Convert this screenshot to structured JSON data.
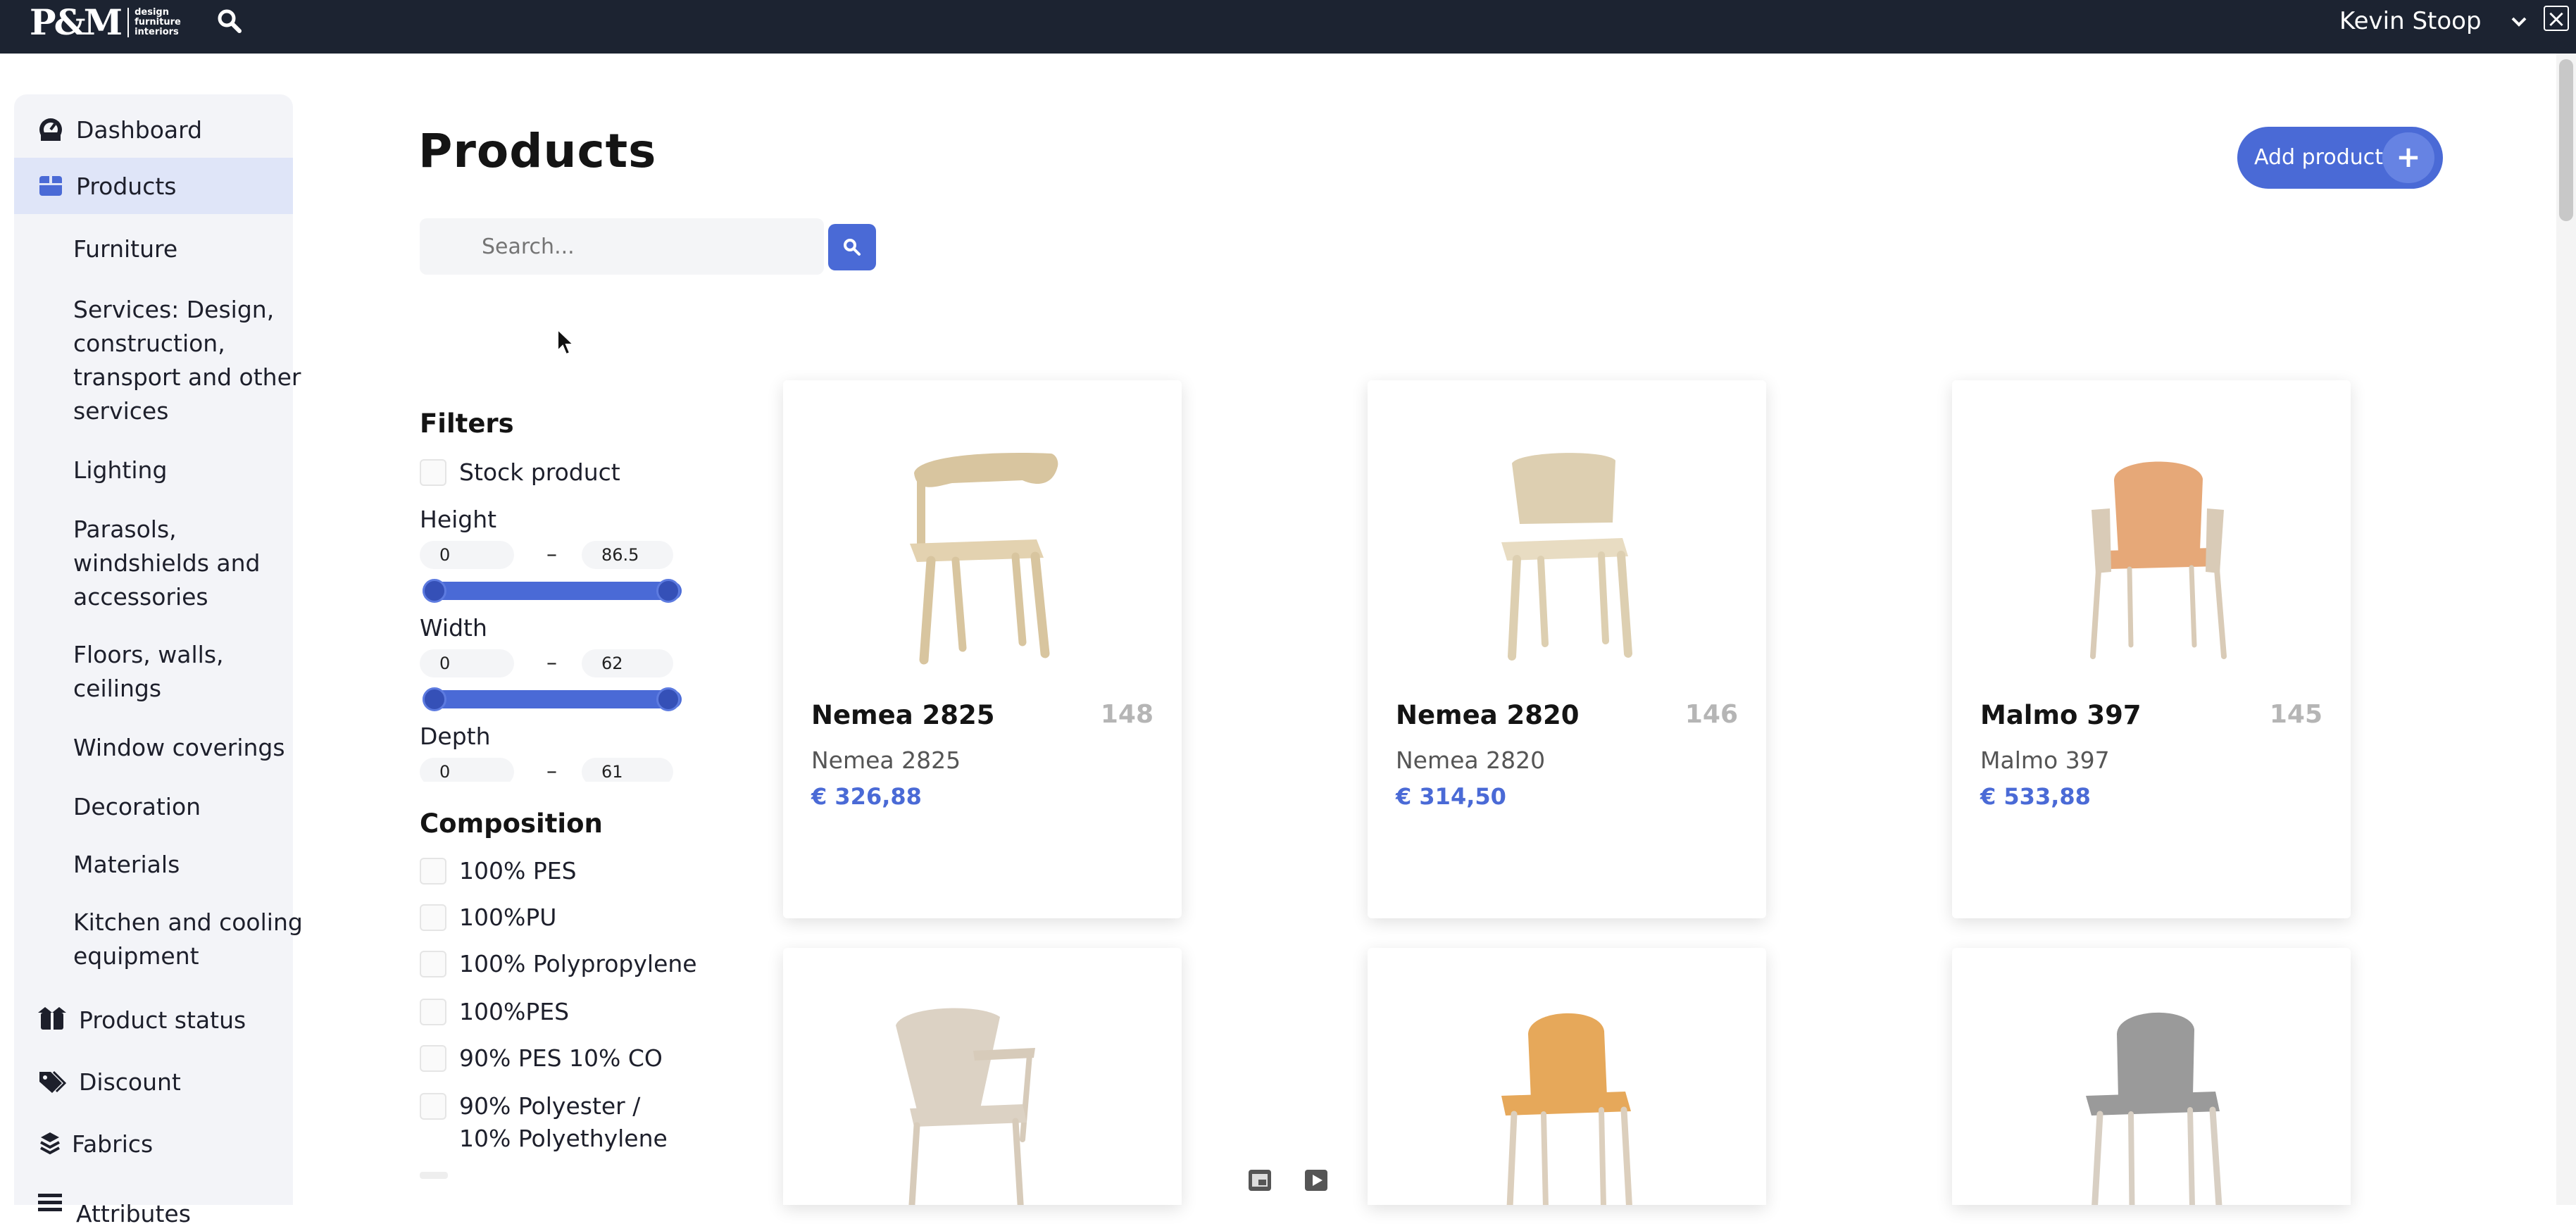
{
  "header": {
    "logo_mark": "P&M",
    "logo_sub": [
      "design",
      "furniture",
      "interiors"
    ],
    "user_name": "Kevin Stoop"
  },
  "sidebar": {
    "items": [
      {
        "label": "Dashboard",
        "icon": "dashboard-icon"
      },
      {
        "label": "Products",
        "icon": "box-icon",
        "active": true
      },
      {
        "label": "Product status",
        "icon": "box-status-icon"
      },
      {
        "label": "Discount",
        "icon": "tags-icon"
      },
      {
        "label": "Fabrics",
        "icon": "layers-icon"
      },
      {
        "label": "Attributes",
        "icon": "list-icon"
      }
    ],
    "subitems": [
      "Furniture",
      "Services: Design, construction, transport and other services",
      "Lighting",
      "Parasols, windshields and accessories",
      "Floors, walls, ceilings",
      "Window coverings",
      "Decoration",
      "Materials",
      "Kitchen and cooling equipment"
    ]
  },
  "page": {
    "title": "Products",
    "add_button": "Add product",
    "add_plus": "+",
    "search_placeholder": "Search..."
  },
  "filters": {
    "heading": "Filters",
    "stock_label": "Stock product",
    "height": {
      "label": "Height",
      "min": "0",
      "max": "86.5"
    },
    "width": {
      "label": "Width",
      "min": "0",
      "max": "62"
    },
    "depth": {
      "label": "Depth",
      "min": "0",
      "max": "61"
    },
    "dash": "–",
    "composition_heading": "Composition",
    "composition": [
      "100% PES",
      "100%PU",
      "100% Polypropylene",
      "100%PES",
      "90% PES 10% CO",
      "90% Polyester / 10% Polyethylene"
    ]
  },
  "products": [
    {
      "name": "Nemea 2825",
      "id": "148",
      "subtitle": "Nemea 2825",
      "price": "€ 326,88",
      "seat_color": "#e3d2b0",
      "frame_color": "#d8c59f"
    },
    {
      "name": "Nemea 2820",
      "id": "146",
      "subtitle": "Nemea 2820",
      "price": "€ 314,50",
      "seat_color": "#e8dcc2",
      "frame_color": "#ddcfb1"
    },
    {
      "name": "Malmo 397",
      "id": "145",
      "subtitle": "Malmo 397",
      "price": "€ 533,88",
      "seat_color": "#e6a878",
      "frame_color": "#d9cbb7"
    },
    {
      "seat_color": "#dcd2c4",
      "frame_color": "#d7cbba"
    },
    {
      "seat_color": "#e6a85a",
      "frame_color": "#dccfbd"
    },
    {
      "seat_color": "#9a9a9a",
      "frame_color": "#d8cfc3"
    }
  ]
}
